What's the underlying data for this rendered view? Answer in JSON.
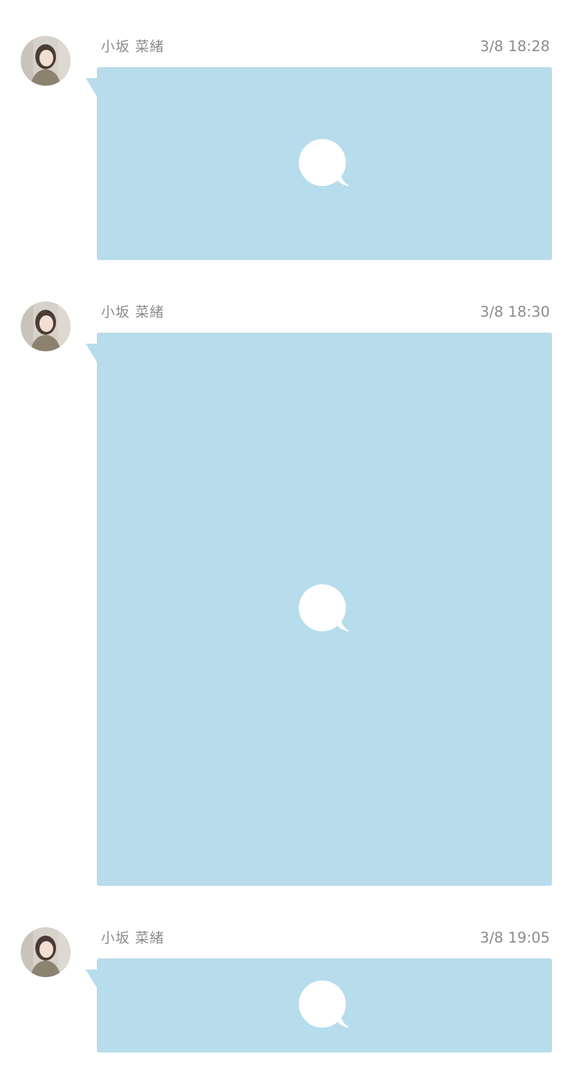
{
  "theme": {
    "bubble_color": "#b7dcec",
    "icon_color": "#ffffff",
    "meta_text_color": "#8c8c8c"
  },
  "messages": [
    {
      "sender": "小坂 菜緒",
      "time": "3/8 18:28",
      "content_icon": "chat-bubble-icon"
    },
    {
      "sender": "小坂 菜緒",
      "time": "3/8 18:30",
      "content_icon": "chat-bubble-icon"
    },
    {
      "sender": "小坂 菜緒",
      "time": "3/8 19:05",
      "content_icon": "chat-bubble-icon"
    }
  ]
}
